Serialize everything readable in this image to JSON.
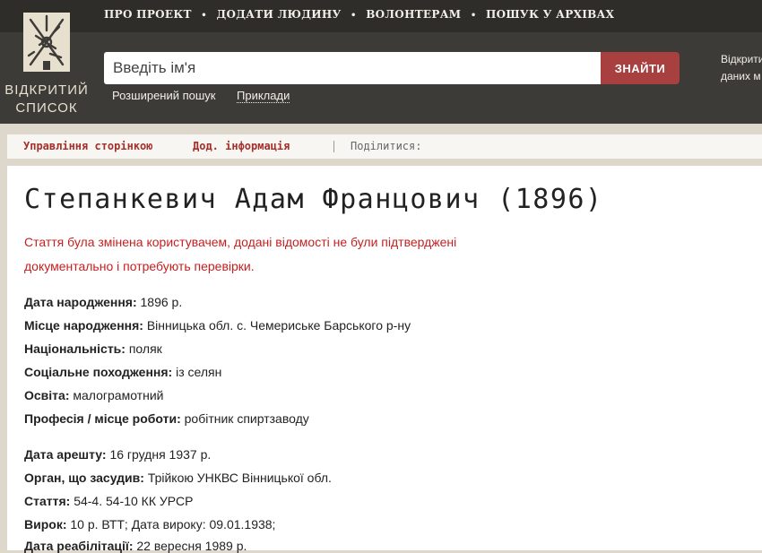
{
  "topnav": {
    "items": [
      "ПРО ПРОЕКТ",
      "ДОДАТИ ЛЮДИНУ",
      "ВОЛОНТЕРАМ",
      "ПОШУК У АРХІВАХ"
    ],
    "separator": "•"
  },
  "logo": {
    "line1": "ВІДКРИТИЙ",
    "line2": "СПИСОК"
  },
  "search": {
    "placeholder": "Введіть ім'я",
    "button": "ЗНАЙТИ",
    "advanced": "Розширений пошук",
    "examples": "Приклади"
  },
  "right_panel": {
    "line1": "Відкрити",
    "line2": "даних м"
  },
  "toolbar": {
    "manage": "Управління сторінкою",
    "more": "Дод. інформація",
    "share": "Поділитися:"
  },
  "person": {
    "title": "Степанкевич Адам Францович (1896)",
    "warning_line1": "Стаття була змінена користувачем, додані відомості не були підтверджені",
    "warning_line2": "документально і потребують перевірки.",
    "fields": [
      {
        "label": "Дата народження:",
        "value": "1896 р."
      },
      {
        "label": "Місце народження:",
        "value": "Вінницька обл. с. Чемериське Барського р-ну"
      },
      {
        "label": "Національність:",
        "value": "поляк"
      },
      {
        "label": "Соціальне походження:",
        "value": "із селян"
      },
      {
        "label": "Освіта:",
        "value": "малограмотний"
      },
      {
        "label": "Професія / місце роботи:",
        "value": "робітник спиртзаводу"
      }
    ],
    "arrest_fields": [
      {
        "label": "Дата арешту:",
        "value": "16 грудня 1937 р."
      },
      {
        "label": "Орган, що засудив:",
        "value": "Трійкою УНКВС Вінницької обл."
      },
      {
        "label": "Стаття:",
        "value": "54-4. 54-10 КК УРСР"
      },
      {
        "label": "Вирок:",
        "value": "10 р. ВТТ; Дата вироку: 09.01.1938;"
      },
      {
        "label": "Дата реабілітації:",
        "value": "22 вересня 1989 р."
      }
    ]
  },
  "colors": {
    "header": "#3d3b38",
    "accent_red": "#a8403f",
    "warning": "#c51f1f"
  }
}
